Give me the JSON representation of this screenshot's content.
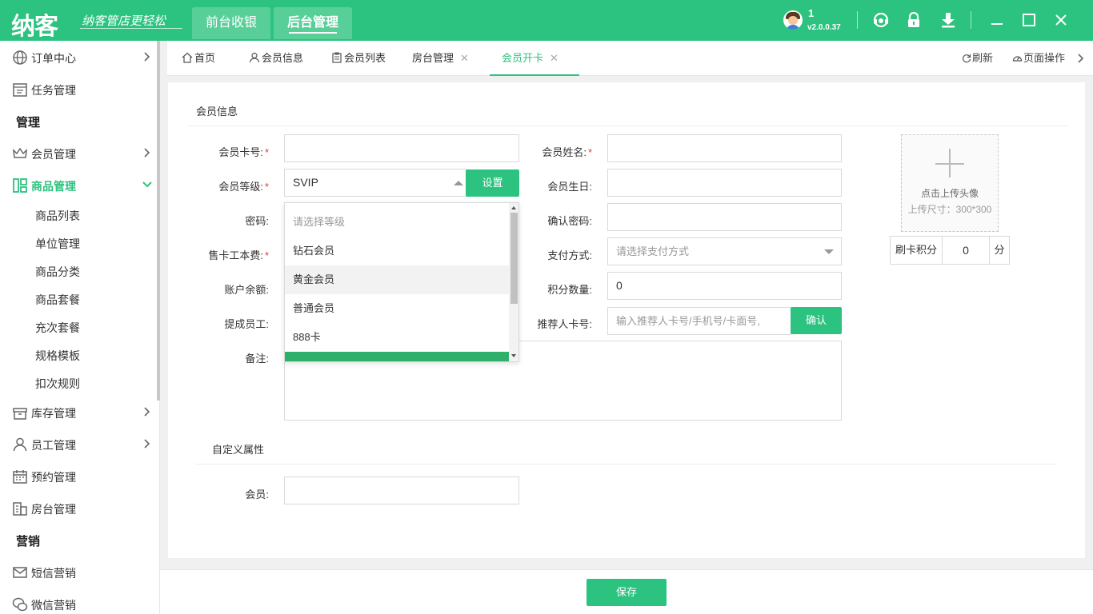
{
  "app": {
    "logo": "纳客",
    "slogan": "纳客管店更轻松",
    "top_tabs": [
      "前台收银",
      "后台管理"
    ],
    "user": "1",
    "version": "v2.0.0.37",
    "accent": "#2cc27f"
  },
  "sidebar": {
    "items": [
      {
        "label": "订单中心",
        "icon": "globe-icon"
      },
      {
        "label": "任务管理",
        "icon": "task-icon"
      },
      {
        "label": "会员管理",
        "icon": "crown-icon"
      },
      {
        "label": "商品管理",
        "icon": "goods-icon"
      },
      {
        "label": "库存管理",
        "icon": "box-icon"
      },
      {
        "label": "员工管理",
        "icon": "user-icon"
      },
      {
        "label": "预约管理",
        "icon": "calendar-icon"
      },
      {
        "label": "房台管理",
        "icon": "building-icon"
      },
      {
        "label": "短信营销",
        "icon": "mail-icon"
      },
      {
        "label": "微信营销",
        "icon": "wechat-icon"
      }
    ],
    "sections": [
      "管理",
      "营销"
    ],
    "sub_items": [
      "商品列表",
      "单位管理",
      "商品分类",
      "商品套餐",
      "充次套餐",
      "规格模板",
      "扣次规则"
    ]
  },
  "tabs": [
    {
      "label": "首页",
      "icon": "home-icon"
    },
    {
      "label": "会员信息",
      "icon": "user-icon"
    },
    {
      "label": "会员列表",
      "icon": "clipboard-icon"
    },
    {
      "label": "房台管理",
      "close": "✕"
    },
    {
      "label": "会员开卡",
      "close": "✕"
    }
  ],
  "tab_actions": {
    "refresh": "刷新",
    "page_ops": "页面操作"
  },
  "form": {
    "section_title": "会员信息",
    "labels": {
      "card_no": "会员卡号:",
      "name": "会员姓名:",
      "level": "会员等级:",
      "birthday": "会员生日:",
      "password": "密码:",
      "confirm_password": "确认密码:",
      "card_fee": "售卡工本费:",
      "payment": "支付方式:",
      "balance": "账户余额:",
      "points": "积分数量:",
      "staff": "提成员工:",
      "referrer": "推荐人卡号:",
      "remark": "备注:"
    },
    "required_mark": "*",
    "level_value": "SVIP",
    "settings_button": "设置",
    "payment_placeholder": "请选择支付方式",
    "points_value": "0",
    "referrer_placeholder": "输入推荐人卡号/手机号/卡面号,",
    "confirm_button": "确认",
    "dropdown": {
      "placeholder": "请选择等级",
      "options": [
        "钻石会员",
        "黄金会员",
        "普通会员",
        "888卡"
      ]
    },
    "upload": {
      "title": "点击上传头像",
      "size_hint": "上传尺寸：300*300"
    },
    "swipe_points": {
      "label": "刷卡积分",
      "value": "0",
      "unit": "分"
    }
  },
  "custom": {
    "section_title": "自定义属性",
    "member_label": "会员:"
  },
  "save_button": "保存"
}
